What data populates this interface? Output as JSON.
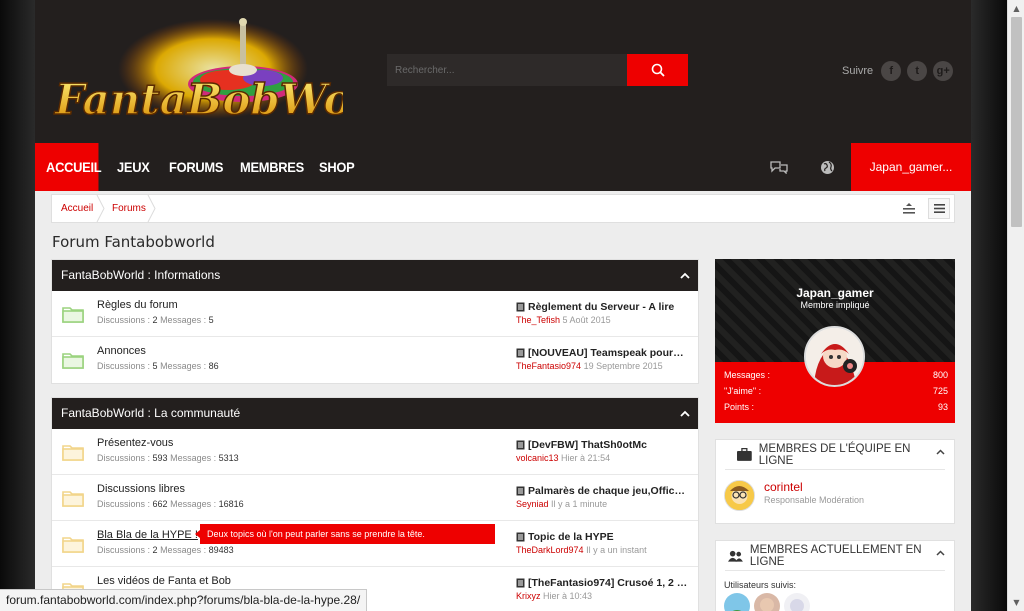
{
  "site": {
    "logo_alt": "FantaBobWorld"
  },
  "search": {
    "placeholder": "Rechercher..."
  },
  "follow": {
    "label": "Suivre",
    "networks": [
      {
        "name": "facebook-icon",
        "glyph": "f"
      },
      {
        "name": "twitter-icon",
        "glyph": "t"
      },
      {
        "name": "googleplus-icon",
        "glyph": "g+"
      }
    ]
  },
  "nav": {
    "items": [
      {
        "label": "ACCUEIL",
        "active": true
      },
      {
        "label": "JEUX",
        "active": false
      },
      {
        "label": "FORUMS",
        "active": false
      },
      {
        "label": "MEMBRES",
        "active": false
      },
      {
        "label": "SHOP",
        "active": false
      }
    ],
    "user_label": "Japan_gamer..."
  },
  "breadcrumb": [
    "Accueil",
    "Forums"
  ],
  "page_title": "Forum Fantabobworld",
  "labels": {
    "discussions": "Discussions :",
    "messages": "Messages :"
  },
  "categories": [
    {
      "title": "FantaBobWorld : Informations",
      "folder_color": "#9bd37f",
      "forums": [
        {
          "title": "Règles du forum",
          "discussions": "2",
          "messages": "5",
          "last_title": "Règlement du Serveur - A lire",
          "last_user": "The_Tefish",
          "last_date": "5 Août 2015"
        },
        {
          "title": "Annonces",
          "discussions": "5",
          "messages": "86",
          "last_title": "[NOUVEAU] Teamspeak pour…",
          "last_user": "TheFantasio974",
          "last_date": "19 Septembre 2015"
        }
      ]
    },
    {
      "title": "FantaBobWorld : La communauté",
      "folder_color": "#f2d58b",
      "forums": [
        {
          "title": "Présentez-vous",
          "discussions": "593",
          "messages": "5313",
          "last_title": "[DevFBW] ThatSh0otMc",
          "last_user": "volcanic13",
          "last_date": "Hier à 21:54"
        },
        {
          "title": "Discussions libres",
          "discussions": "662",
          "messages": "16816",
          "last_title": "Palmarès de chaque jeu,Offic…",
          "last_user": "Seyniad",
          "last_date": "Il y a 1 minute"
        },
        {
          "title": "Bla Bla de la HYPE !",
          "discussions": "2",
          "messages": "89483",
          "last_title": "Topic de la HYPE",
          "last_user": "TheDarkLord974",
          "last_date": "Il y a un instant"
        },
        {
          "title": "Les vidéos de Fanta et Bob",
          "discussions": "",
          "messages": "",
          "last_title": "[TheFantasio974] Crusoé 1, 2 …",
          "last_user": "Krixyz",
          "last_date": "Hier à 10:43"
        }
      ]
    }
  ],
  "tooltip": "Deux topics où l'on peut parler sans se prendre la tête.",
  "profile": {
    "name": "Japan_gamer",
    "rank": "Membre impliqué",
    "stats": [
      {
        "label": "Messages :",
        "value": "800"
      },
      {
        "label": "\"J'aime\" :",
        "value": "725"
      },
      {
        "label": "Points :",
        "value": "93"
      }
    ]
  },
  "staff_box": {
    "title": "MEMBRES DE L'ÉQUIPE EN LIGNE",
    "member": {
      "name": "corintel",
      "role": "Responsable Modération"
    }
  },
  "online_box": {
    "title": "MEMBRES ACTUELLEMENT EN LIGNE",
    "followed_label": "Utilisateurs suivis:"
  },
  "status_url": "forum.fantabobworld.com/index.php?forums/bla-bla-de-la-hype.28/"
}
